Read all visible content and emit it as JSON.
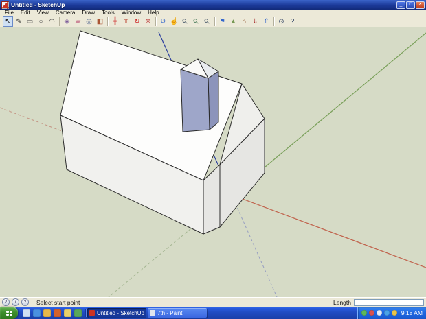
{
  "window": {
    "title": "Untitled - SketchUp",
    "buttons": {
      "minimize": "_",
      "maximize": "□",
      "close": "×"
    }
  },
  "menu": {
    "items": [
      "File",
      "Edit",
      "View",
      "Camera",
      "Draw",
      "Tools",
      "Window",
      "Help"
    ]
  },
  "toolbar": {
    "groups": [
      {
        "icons": [
          {
            "name": "select-tool",
            "glyph": "↖",
            "color": "#111111"
          },
          {
            "name": "line-tool",
            "glyph": "✎",
            "color": "#333333"
          },
          {
            "name": "rectangle-tool",
            "glyph": "▭",
            "color": "#444444"
          },
          {
            "name": "circle-tool",
            "glyph": "○",
            "color": "#444444"
          },
          {
            "name": "arc-tool",
            "glyph": "◠",
            "color": "#444444"
          }
        ]
      },
      {
        "icons": [
          {
            "name": "make-component-tool",
            "glyph": "◈",
            "color": "#7a5a9a"
          },
          {
            "name": "eraser-tool",
            "glyph": "▰",
            "color": "#cc8899"
          },
          {
            "name": "tape-measure-tool",
            "glyph": "◎",
            "color": "#667799"
          },
          {
            "name": "paint-bucket-tool",
            "glyph": "◧",
            "color": "#aa5533"
          }
        ]
      },
      {
        "icons": [
          {
            "name": "move-tool",
            "glyph": "╋",
            "color": "#cc2222"
          },
          {
            "name": "push-pull-tool",
            "glyph": "⇧",
            "color": "#bb4433"
          },
          {
            "name": "rotate-tool",
            "glyph": "↻",
            "color": "#cc2222"
          },
          {
            "name": "offset-tool",
            "glyph": "⊚",
            "color": "#bb3333"
          }
        ]
      },
      {
        "icons": [
          {
            "name": "orbit-tool",
            "glyph": "↺",
            "color": "#3366cc"
          },
          {
            "name": "pan-tool",
            "glyph": "☝",
            "color": "#cc9966"
          },
          {
            "name": "zoom-tool",
            "glyph": "⚲",
            "color": "#445566"
          },
          {
            "name": "zoom-extents-tool",
            "glyph": "⚲",
            "color": "#447755"
          },
          {
            "name": "zoom-previous-tool",
            "glyph": "⚲",
            "color": "#445566"
          }
        ]
      },
      {
        "icons": [
          {
            "name": "get-current-view-tool",
            "glyph": "⚑",
            "color": "#3366cc"
          },
          {
            "name": "toggle-terrain-tool",
            "glyph": "▲",
            "color": "#779955"
          },
          {
            "name": "place-model-tool",
            "glyph": "⌂",
            "color": "#996644"
          },
          {
            "name": "get-models-tool",
            "glyph": "⇓",
            "color": "#aa3333"
          },
          {
            "name": "share-model-tool",
            "glyph": "⇑",
            "color": "#3366cc"
          }
        ]
      },
      {
        "icons": [
          {
            "name": "model-info-tool",
            "glyph": "⊙",
            "color": "#334466"
          },
          {
            "name": "instructor-tool",
            "glyph": "?",
            "color": "#334466"
          }
        ]
      }
    ]
  },
  "viewport": {
    "colors": {
      "background": "#d6dbc6",
      "axis_red": "#c0604a",
      "axis_green": "#7aa05a",
      "axis_blue": "#2c3e9e",
      "axis_red_dashed": "#c08878",
      "axis_green_dashed": "#98ac84",
      "axis_blue_dashed": "#8890c0",
      "roof": "#fdfdfc",
      "gable": "#efefec",
      "right_wall": "#e6e6e3",
      "front_wall": "#f1f1ee",
      "chimney_front": "#9ea6c9",
      "chimney_side": "#8c94bb",
      "chimney_cap_left": "#fafaf8",
      "chimney_cap_right": "#e9ecef"
    }
  },
  "statusbar": {
    "icons": [
      {
        "name": "status-help-icon",
        "glyph": "?"
      },
      {
        "name": "status-info-icon",
        "glyph": "i"
      },
      {
        "name": "status-question-icon",
        "glyph": "?"
      }
    ],
    "hint": "Select start point",
    "length_label": "Length",
    "length_value": ""
  },
  "taskbar": {
    "quick_launch": [
      {
        "name": "show-desktop-icon",
        "color": "#cfe0f4"
      },
      {
        "name": "internet-explorer-icon",
        "color": "#4a90e0"
      },
      {
        "name": "email-icon",
        "color": "#e8b84a"
      },
      {
        "name": "media-player-icon",
        "color": "#d4622a"
      },
      {
        "name": "folder-icon",
        "color": "#e8d06a"
      },
      {
        "name": "app-shortcut-icon",
        "color": "#5aa85a"
      }
    ],
    "tasks": [
      {
        "label": "Untitled - SketchUp",
        "icon_color": "#cc3322"
      },
      {
        "label": "7th - Paint",
        "icon_color": "#dfe4ee"
      }
    ],
    "tray_icons": [
      {
        "name": "antivirus-tray-icon",
        "color": "#5cb85c"
      },
      {
        "name": "update-tray-icon",
        "color": "#d9534f"
      },
      {
        "name": "volume-tray-icon",
        "color": "#e4ecf8"
      },
      {
        "name": "network-tray-icon",
        "color": "#4aa3e8"
      },
      {
        "name": "messenger-tray-icon",
        "color": "#e8c44a"
      }
    ],
    "clock": "9:18 AM"
  }
}
